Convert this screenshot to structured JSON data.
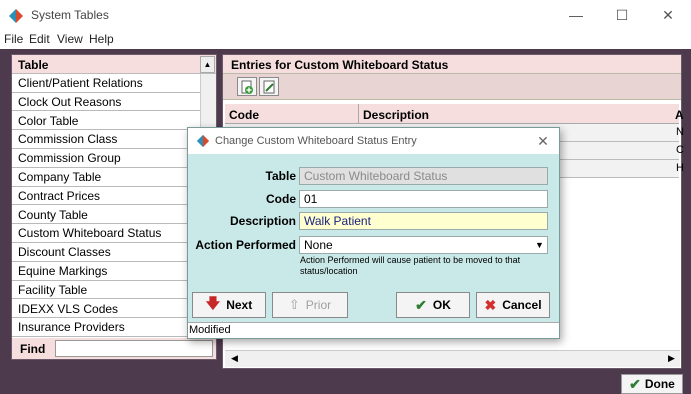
{
  "window": {
    "title": "System Tables",
    "minimize_glyph": "—",
    "maximize_glyph": "☐",
    "close_glyph": "✕"
  },
  "menu": [
    "File",
    "Edit",
    "View",
    "Help"
  ],
  "left_panel": {
    "header": "Table",
    "items": [
      "Client/Patient Relations",
      "Clock Out Reasons",
      "Color Table",
      "Commission Class",
      "Commission Group",
      "Company Table",
      "Contract Prices",
      "County Table",
      "Custom Whiteboard Status",
      "Discount Classes",
      "Equine Markings",
      "Facility Table",
      "IDEXX VLS Codes",
      "Insurance Providers"
    ],
    "find_label": "Find",
    "find_value": ""
  },
  "right_panel": {
    "header": "Entries for Custom Whiteboard Status",
    "columns": [
      "Code",
      "Description",
      "A"
    ],
    "row_edge_letters": [
      "N",
      "C",
      "H"
    ]
  },
  "done_button": "Done",
  "dialog": {
    "title": "Change Custom Whiteboard Status Entry",
    "labels": {
      "table": "Table",
      "code": "Code",
      "description": "Description",
      "action": "Action Performed"
    },
    "values": {
      "table": "Custom Whiteboard Status",
      "code": "01",
      "description": "Walk Patient",
      "action": "None"
    },
    "action_note": "Action Performed will cause patient to be moved to that status/location",
    "buttons": {
      "next": "Next",
      "prior": "Prior",
      "ok": "OK",
      "cancel": "Cancel"
    },
    "status": "Modified"
  },
  "colors": {
    "background": "#4d3a4d",
    "dialog": "#c9e8e8",
    "header_pink": "#f6dede",
    "description_field": "#ffffd0"
  }
}
